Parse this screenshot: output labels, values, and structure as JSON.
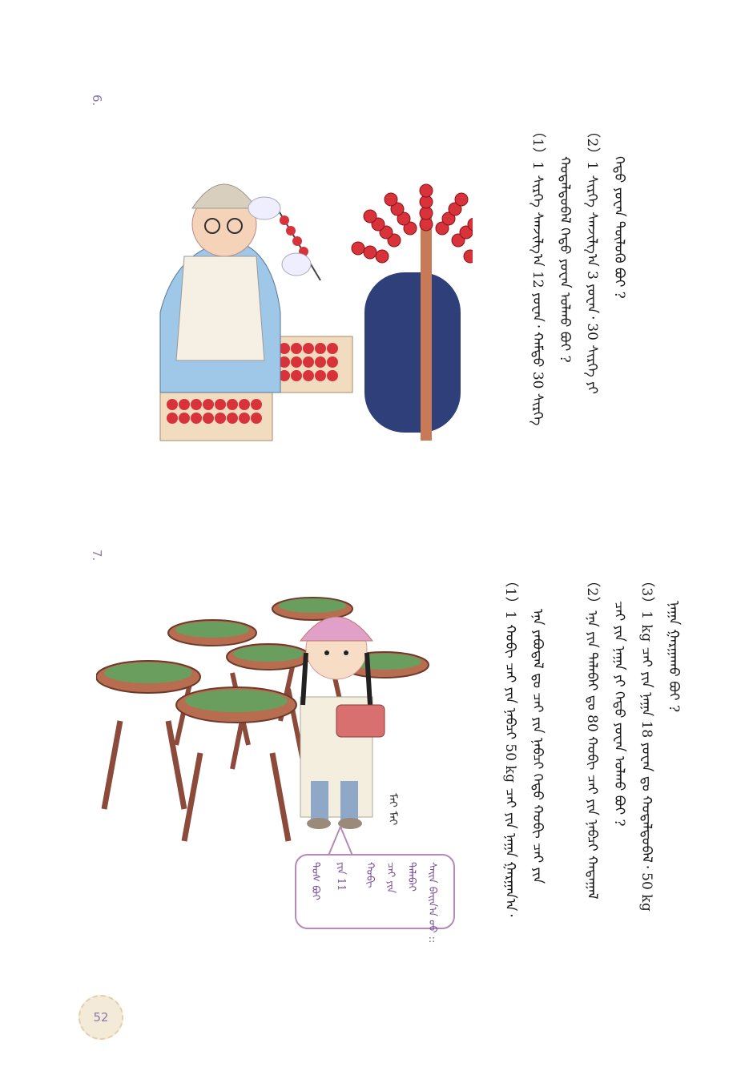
{
  "page_number": "52",
  "problem6": {
    "number": "6.",
    "q1_line1": "（1）1 ᠰᠢᠷᠬᠡ ᠰᠠᠨᠵᠢᠯᠭ᠎ᠠ 12 ᠶᠤᠸᠠᠨ᠂ ᠬᠠᠮᠲᠤ 30 ᠰᠢᠷᠬᠡ",
    "q2_line1": "（2）1 ᠰᠢᠷᠬᠡ ᠰᠠᠨᠵᠢᠯᠭ᠎ᠠ 3 ᠶᠤᠸᠠᠨ᠂ 30 ᠰᠢᠷᠬᠡ ᠶᠢ",
    "q2_line2": "ᠬᠤᠳᠠᠯᠳᠤᠪᠠᠯ ᠬᠡᠳᠦ ᠶᠤᠸᠠᠨ ᠣᠯᠬᠤ ᠪᠤᠢ ?",
    "q_tail": "ᠬᠡᠳᠦ ᠶᠤᠸᠠᠨ ᠲᠥᠯᠥᠬᠦ ᠪᠤᠢ ?"
  },
  "problem7": {
    "number": "7.",
    "q1_line1": "（1）1 ᠬᠤᠪᠢ ᠴᠠᠢ ᠶᠢᠨ ᠨᠠᠪᠴᠢ 50 kg ᠴᠠᠢ ᠶᠢᠨ ᠨᠠᠭᠠ ᠭᠠᠷᠭᠠᠨ᠎ᠠ᠂",
    "q1_line2": "ᠡᠨᠡ ᠶᠠᠪᠤᠳᠠᠯ ᠳᠤ ᠴᠠᠢ ᠶᠢᠨ ᠨᠠᠪᠴᠢ ᠬᠡᠳᠦ ᠬᠤᠪᠢ ᠴᠠᠢ ᠶᠢᠨ",
    "q1_line3": "ᠨᠠᠭᠠ ᠭᠠᠷᠭᠠᠬᠤ ᠪᠤᠢ ?",
    "q2_line1": "（2）ᠡᠨᠡ ᠶᠢᠨ ᠲᠠᠯᠠᠪᠠᠢ ᠳᠤ 80 ᠬᠤᠪᠢ ᠴᠠᠢ ᠶᠢᠨ ᠨᠠᠪᠴᠢ ᠬᠠᠳᠠᠭᠠᠯ",
    "q3_line1": "（3）1 kg ᠴᠠᠢ ᠶᠢᠨ ᠨᠠᠭᠠ 18 ᠶᠤᠸᠠᠨ ᠳᠤ ᠬᠤᠳᠠᠯᠳᠤᠪᠠᠯ᠂ 50 kg",
    "q3_line2": "ᠴᠠᠢ ᠶᠢᠨ ᠨᠠᠭᠠ ᠶᠢ ᠬᠡᠳᠦ ᠶᠤᠸᠠᠨ ᠣᠯᠬᠤ ᠪᠤᠢ ?",
    "bubble_lines": [
      "ᠰᠠᠢᠨ ᠪᠠᠢᠨ᠎ᠠ ᠦᠦ ::",
      "ᠲᠠᠯᠠᠪᠠᠢ",
      "ᠴᠠᠢ ᠶᠢᠨ",
      "ᠬᠤᠪᠢ",
      "ᠶᠢᠨ 11",
      "ᠲᠤᠰ ᠪᠤᠢ"
    ],
    "signature": "ᠮᠡᠢ ᠮᠡᠢ"
  },
  "colors": {
    "accent": "#8a7aa6",
    "candy": "#d8323a",
    "tea": "#6a9e5e",
    "wood": "#8b4a3a"
  }
}
